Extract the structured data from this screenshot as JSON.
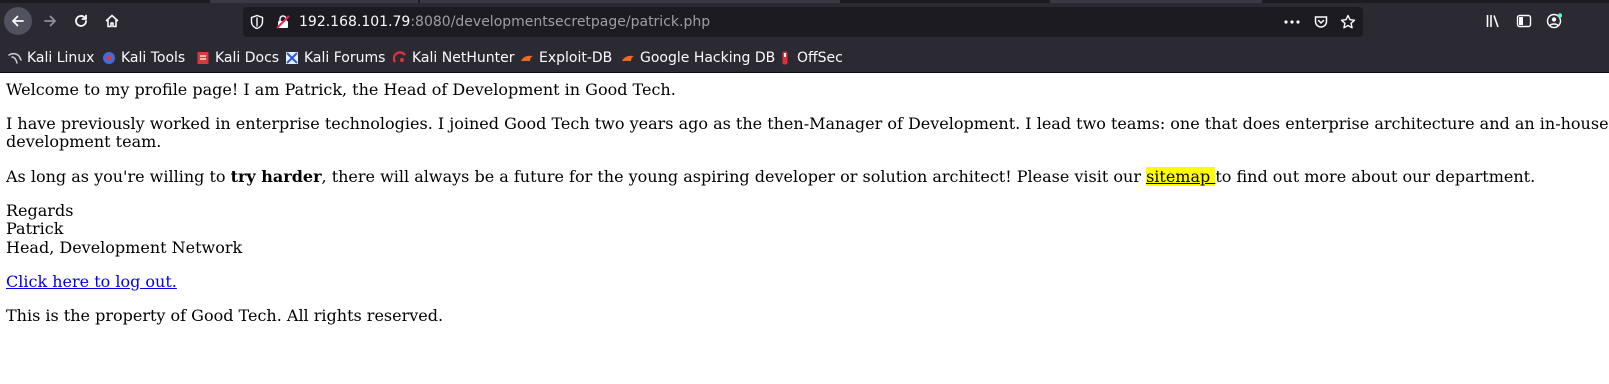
{
  "browser": {
    "url_host": "192.168.101.79",
    "url_rest": ":8080/developmentsecretpage/patrick.php",
    "icons": [
      "back-icon",
      "forward-icon",
      "reload-icon",
      "home-icon",
      "shield-icon",
      "insecure-lock-icon",
      "page-actions-icon",
      "pocket-icon",
      "bookmark-star-icon",
      "library-icon",
      "sidebar-icon",
      "profile-icon"
    ],
    "accent": "#2b2a33"
  },
  "bookmarks": [
    {
      "label": "Kali Linux"
    },
    {
      "label": "Kali Tools"
    },
    {
      "label": "Kali Docs"
    },
    {
      "label": "Kali Forums"
    },
    {
      "label": "Kali NetHunter"
    },
    {
      "label": "Exploit-DB"
    },
    {
      "label": "Google Hacking DB"
    },
    {
      "label": "OffSec"
    }
  ],
  "page": {
    "welcome": "Welcome to my profile page! I am Patrick, the Head of Development in Good Tech.",
    "bio_line1": "I have previously worked in enterprise technologies. I joined Good Tech two years ago as the then-Manager of Development. I lead two teams: one that does enterprise architecture and an in-house",
    "bio_line2": "development team.",
    "cta_pre": "As long as you're willing to ",
    "cta_bold": "try harder",
    "cta_mid": ", there will always be a future for the young aspiring developer or solution architect! Please visit our ",
    "cta_link": "sitemap ",
    "cta_post": "to find out more about our department.",
    "regards": "Regards",
    "name": "Patrick",
    "title": "Head, Development Network",
    "logout": "Click here to log out.",
    "footer": "This is the property of Good Tech. All rights reserved."
  }
}
